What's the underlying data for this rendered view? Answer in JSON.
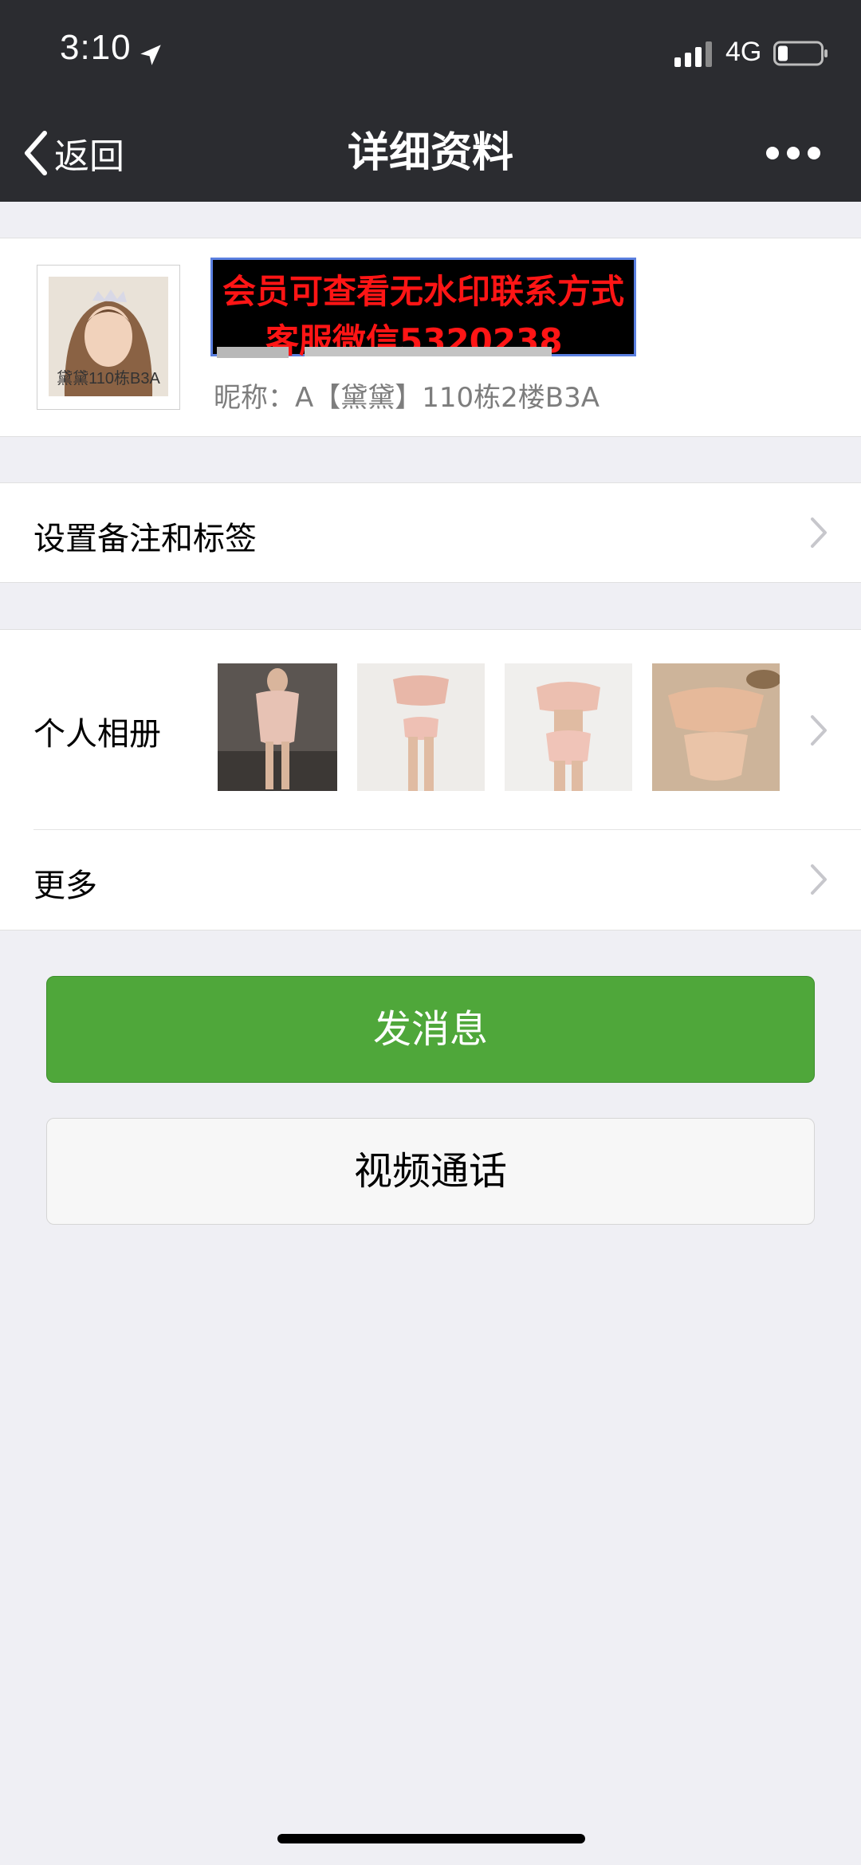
{
  "status_bar": {
    "time": "3:10",
    "network": "4G"
  },
  "nav": {
    "back_label": "返回",
    "title": "详细资料"
  },
  "profile": {
    "avatar_caption": "黛黛110栋B3A",
    "watermark_line1": "会员可查看无水印联系方式",
    "watermark_line2": "客服微信5320238",
    "nickname": "昵称：A【黛黛】110栋2楼B3A"
  },
  "rows": {
    "remark_label": "设置备注和标签",
    "album_label": "个人相册",
    "more_label": "更多"
  },
  "buttons": {
    "send_message": "发消息",
    "video_call": "视频通话"
  },
  "colors": {
    "header_bg": "#2b2c30",
    "page_bg": "#efeff4",
    "primary_green": "#4fa73a",
    "watermark_text": "#ff1515"
  }
}
